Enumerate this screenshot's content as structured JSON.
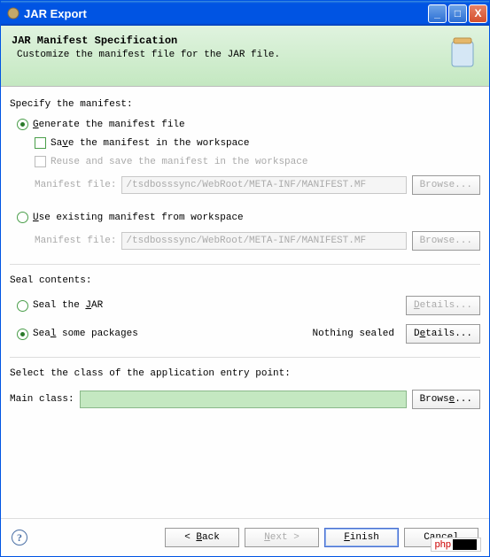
{
  "titlebar": {
    "title": "JAR Export"
  },
  "header": {
    "title": "JAR Manifest Specification",
    "subtitle": "Customize the manifest file for the JAR file."
  },
  "manifest": {
    "section_label": "Specify the manifest:",
    "generate_label": "Generate the manifest file",
    "save_label": "Save the manifest in the workspace",
    "reuse_label": "Reuse and save the manifest in the workspace",
    "file_label_1": "Manifest file:",
    "file_value_1": "/tsdbosssync/WebRoot/META-INF/MANIFEST.MF",
    "browse_1": "Browse...",
    "use_existing_label": "Use existing manifest from workspace",
    "file_label_2": "Manifest file:",
    "file_value_2": "/tsdbosssync/WebRoot/META-INF/MANIFEST.MF",
    "browse_2": "Browse..."
  },
  "seal": {
    "section_label": "Seal contents:",
    "seal_jar_label": "Seal the JAR",
    "details_1": "Details...",
    "seal_some_label": "Seal some packages",
    "status": "Nothing sealed",
    "details_2": "Details..."
  },
  "mainclass": {
    "section_label": "Select the class of the application entry point:",
    "label": "Main class:",
    "value": "",
    "browse": "Browse..."
  },
  "footer": {
    "back": "< Back",
    "next": "Next >",
    "finish": "Finish",
    "cancel": "Cancel"
  },
  "watermark": {
    "text": "php"
  }
}
